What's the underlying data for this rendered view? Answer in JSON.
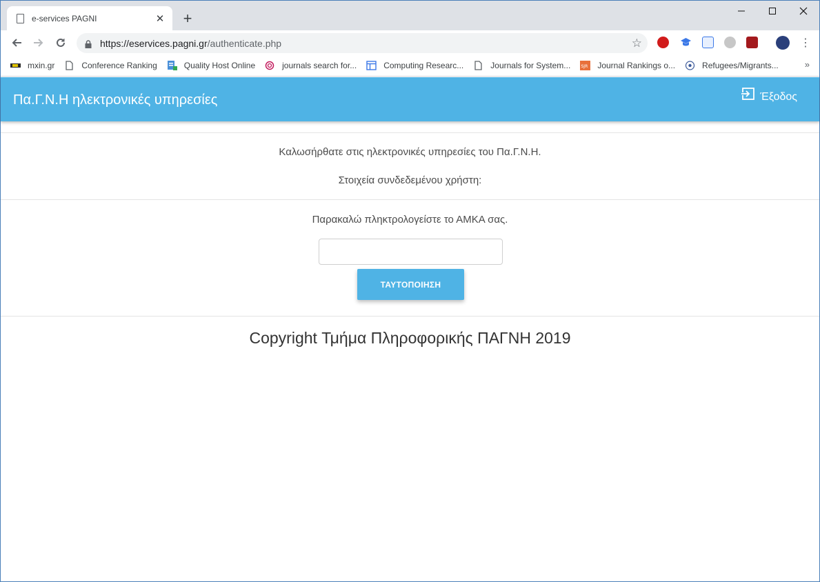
{
  "browser": {
    "tab_title": "e-services PAGNI",
    "new_tab": "+",
    "close_tab": "✕",
    "url_host": "https://eservices.pagni.gr",
    "url_path": "/authenticate.php",
    "bookmarks": [
      {
        "label": "mxin.gr",
        "icon": "mxin-icon"
      },
      {
        "label": "Conference Ranking",
        "icon": "page-icon"
      },
      {
        "label": "Quality Host Online",
        "icon": "doc-green-icon"
      },
      {
        "label": "journals search for...",
        "icon": "spiral-icon"
      },
      {
        "label": "Computing Researc...",
        "icon": "layout-icon"
      },
      {
        "label": "Journals for System...",
        "icon": "page-icon"
      },
      {
        "label": "Journal Rankings o...",
        "icon": "sjr-icon"
      },
      {
        "label": "Refugees/Migrants...",
        "icon": "unhcr-icon"
      }
    ],
    "bookmarks_more": "»"
  },
  "header": {
    "brand": "Πα.Γ.Ν.Η ηλεκτρονικές υπηρεσίες",
    "logout_label": "Έξοδος"
  },
  "main": {
    "welcome": "Καλωσήρθατε στις ηλεκτρονικές υπηρεσίες του Πα.Γ.Ν.Η.",
    "user_details": "Στοιχεία συνδεδεμένου χρήστη:",
    "prompt": "Παρακαλώ πληκτρολογείστε το ΑΜΚΑ σας.",
    "amka_value": "",
    "auth_button": "ΤΑΥΤΟΠΟΙΗΣΗ"
  },
  "footer": {
    "copyright": "Copyright Τμήμα Πληροφορικής ΠΑΓΝΗ 2019"
  },
  "colors": {
    "accent": "#4fb3e5",
    "tabstrip": "#dee1e6"
  }
}
